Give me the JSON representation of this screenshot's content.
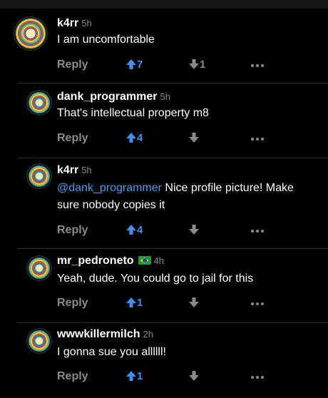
{
  "comments": [
    {
      "user": "k4rr",
      "time": "5h",
      "text": "I am uncomfortable",
      "reply": "Reply",
      "upvotes": "7",
      "downvotes": "1",
      "more_icon": "more-horizontal-icon"
    },
    {
      "user": "dank_programmer",
      "time": "5h",
      "text": "That's intellectual property m8",
      "reply": "Reply",
      "upvotes": "4",
      "downvotes": ""
    },
    {
      "user": "k4rr",
      "time": "5h",
      "mention": "@dank_programmer",
      "text": " Nice profile picture! Make sure nobody copies it",
      "reply": "Reply",
      "upvotes": "4",
      "downvotes": ""
    },
    {
      "user": "mr_pedroneto",
      "flag": "brazil-flag-icon",
      "time": "4h",
      "text": "Yeah, dude. You could go to jail for this",
      "reply": "Reply",
      "upvotes": "1",
      "downvotes": ""
    },
    {
      "user": "wwwkillermilch",
      "time": "2h",
      "text": "I gonna sue you allllll!",
      "reply": "Reply",
      "upvotes": "1",
      "downvotes": ""
    }
  ],
  "colors": {
    "background": "#000000",
    "upvote": "#3d8ff0",
    "muted": "#8a8a8a",
    "mention": "#4a9bf2"
  }
}
